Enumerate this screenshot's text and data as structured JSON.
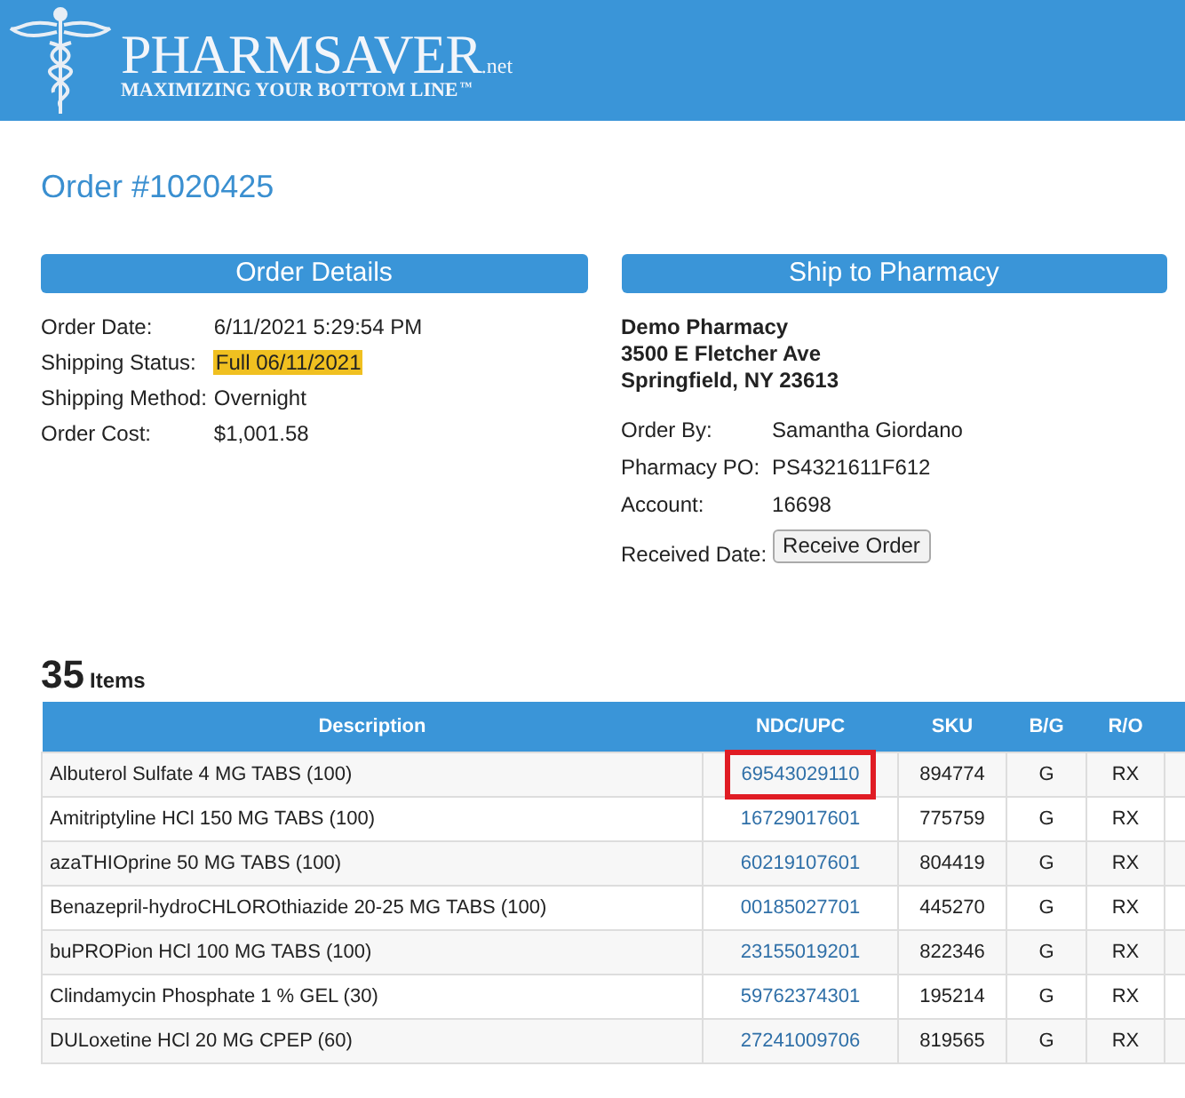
{
  "header": {
    "logo": {
      "name": "PHARMSAVER",
      "suffix": ".net",
      "tagline": "MAXIMIZING YOUR BOTTOM LINE",
      "trademark": "™"
    }
  },
  "order_title": "Order #1020425",
  "order_details": {
    "title": "Order Details",
    "fields": [
      {
        "label": "Order Date:",
        "value": "6/11/2021 5:29:54 PM",
        "highlighted": false
      },
      {
        "label": "Shipping Status:",
        "value": "Full 06/11/2021",
        "highlighted": true
      },
      {
        "label": "Shipping Method:",
        "value": "Overnight",
        "highlighted": false
      },
      {
        "label": "Order Cost:",
        "value": "$1,001.58",
        "highlighted": false
      }
    ]
  },
  "ship_to": {
    "title": "Ship to Pharmacy",
    "address": [
      "Demo Pharmacy",
      "3500 E Fletcher Ave",
      "Springfield, NY 23613"
    ],
    "fields": [
      {
        "label": "Order By:",
        "value": "Samantha Giordano"
      },
      {
        "label": "Pharmacy PO:",
        "value": "PS4321611F612"
      },
      {
        "label": "Account:",
        "value": "16698"
      }
    ],
    "received": {
      "label": "Received Date:",
      "button": "Receive Order"
    }
  },
  "items": {
    "count": "35",
    "label": "Items",
    "columns": [
      "Description",
      "NDC/UPC",
      "SKU",
      "B/G",
      "R/O"
    ],
    "rows": [
      {
        "description": "Albuterol Sulfate 4 MG TABS (100)",
        "ndc": "69543029110",
        "sku": "894774",
        "bg": "G",
        "ro": "RX",
        "highlighted": true
      },
      {
        "description": "Amitriptyline HCl 150 MG TABS (100)",
        "ndc": "16729017601",
        "sku": "775759",
        "bg": "G",
        "ro": "RX",
        "highlighted": false
      },
      {
        "description": "azaTHIOprine 50 MG TABS (100)",
        "ndc": "60219107601",
        "sku": "804419",
        "bg": "G",
        "ro": "RX",
        "highlighted": false
      },
      {
        "description": "Benazepril-hydroCHLOROthiazide 20-25 MG TABS (100)",
        "ndc": "00185027701",
        "sku": "445270",
        "bg": "G",
        "ro": "RX",
        "highlighted": false
      },
      {
        "description": "buPROPion HCl 100 MG TABS (100)",
        "ndc": "23155019201",
        "sku": "822346",
        "bg": "G",
        "ro": "RX",
        "highlighted": false
      },
      {
        "description": "Clindamycin Phosphate 1 % GEL (30)",
        "ndc": "59762374301",
        "sku": "195214",
        "bg": "G",
        "ro": "RX",
        "highlighted": false
      },
      {
        "description": "DULoxetine HCl 20 MG CPEP (60)",
        "ndc": "27241009706",
        "sku": "819565",
        "bg": "G",
        "ro": "RX",
        "highlighted": false
      }
    ]
  }
}
